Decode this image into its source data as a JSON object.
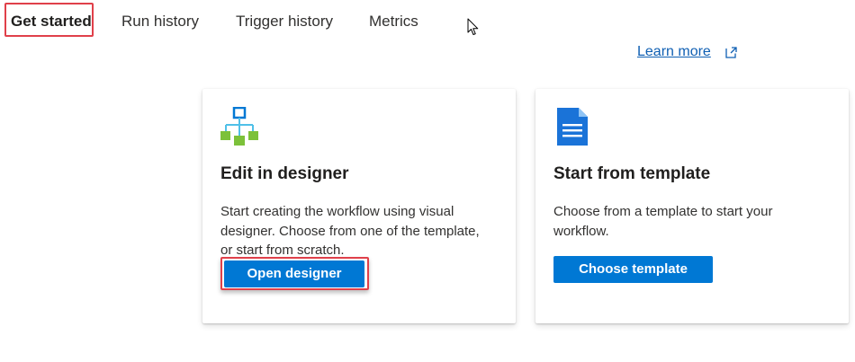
{
  "tabs": [
    {
      "label": "Get started",
      "active": true
    },
    {
      "label": "Run history",
      "active": false
    },
    {
      "label": "Trigger history",
      "active": false
    },
    {
      "label": "Metrics",
      "active": false
    }
  ],
  "learn_more": {
    "label": "Learn more",
    "icon": "external-link-icon"
  },
  "cards": {
    "designer": {
      "icon": "workflow-designer-icon",
      "title": "Edit in designer",
      "description": "Start creating the workflow using visual designer. Choose from one of the template, or start from scratch.",
      "button_label": "Open designer"
    },
    "template": {
      "icon": "document-template-icon",
      "title": "Start from template",
      "description": "Choose from a template to start your workflow.",
      "button_label": "Choose template"
    }
  },
  "colors": {
    "accent": "#0078d4",
    "link": "#0f5fb3",
    "highlight": "#e0404a"
  }
}
